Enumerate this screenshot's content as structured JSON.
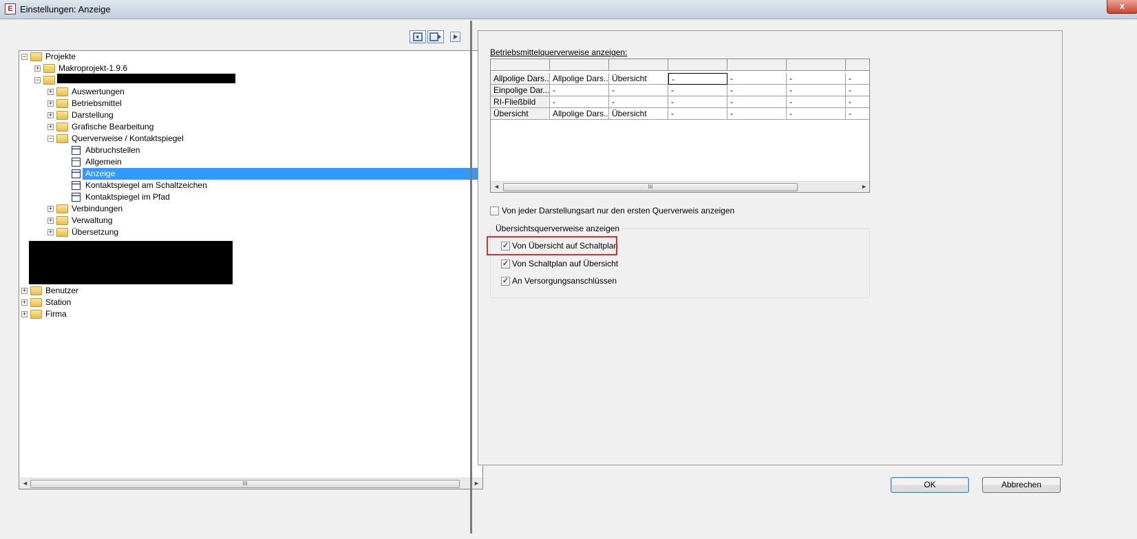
{
  "window": {
    "title": "Einstellungen: Anzeige",
    "close_label": "x"
  },
  "tree": {
    "nodes": [
      {
        "label": "Projekte",
        "expander": "−"
      },
      {
        "label": "Makroprojekt-1.9.6",
        "expander": "+"
      },
      {
        "label": "",
        "expander": "−"
      },
      {
        "label": "Auswertungen",
        "expander": "+"
      },
      {
        "label": "Betriebsmittel",
        "expander": "+"
      },
      {
        "label": "Darstellung",
        "expander": "+"
      },
      {
        "label": "Grafische Bearbeitung",
        "expander": "+"
      },
      {
        "label": "Querverweise / Kontaktspiegel",
        "expander": "−"
      },
      {
        "label": "Abbruchstellen"
      },
      {
        "label": "Allgemein"
      },
      {
        "label": "Anzeige",
        "selected": true
      },
      {
        "label": "Kontaktspiegel am Schaltzeichen"
      },
      {
        "label": "Kontaktspiegel im Pfad"
      },
      {
        "label": "Verbindungen",
        "expander": "+"
      },
      {
        "label": "Verwaltung",
        "expander": "+"
      },
      {
        "label": "Übersetzung",
        "expander": "+"
      },
      {
        "label": "Benutzer",
        "expander": "+"
      },
      {
        "label": "Station",
        "expander": "+"
      },
      {
        "label": "Firma",
        "expander": "+"
      }
    ],
    "scroll_grip": "III",
    "scroll_left": "◄",
    "scroll_right": "►"
  },
  "panel": {
    "table_label": "Betriebsmittelquerverweise anzeigen:",
    "rows": [
      [
        "Allpolige Dars...",
        "Allpolige Dars...",
        "Übersicht",
        "-",
        "-",
        "-",
        "-"
      ],
      [
        "Einpolige Dar...",
        "-",
        "-",
        "-",
        "-",
        "-",
        "-"
      ],
      [
        "RI-Fließbild",
        "-",
        "-",
        "-",
        "-",
        "-",
        "-"
      ],
      [
        "Übersicht",
        "Allpolige Dars...",
        "Übersicht",
        "-",
        "-",
        "-",
        "-"
      ]
    ],
    "first_only": {
      "label": "Von jeder Darstellungsart nur den ersten Querverweis anzeigen",
      "checked": false
    },
    "overview_group": {
      "title": "Übersichtsquerverweise anzeigen",
      "options": [
        {
          "label": "Von Übersicht auf Schaltplan",
          "checked": true
        },
        {
          "label": "Von Schaltplan auf Übersicht",
          "checked": true
        },
        {
          "label": "An Versorgungsanschlüssen",
          "checked": true
        }
      ]
    }
  },
  "buttons": {
    "ok": "OK",
    "cancel": "Abbrechen"
  },
  "check_mark": "✓"
}
